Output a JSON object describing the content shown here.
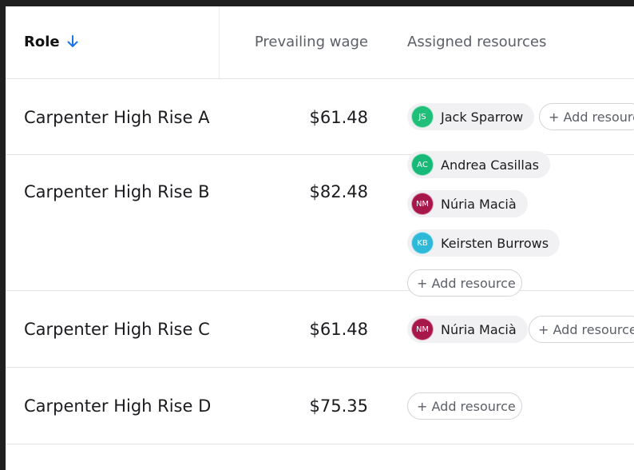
{
  "table": {
    "headers": {
      "role": "Role",
      "wage": "Prevailing wage",
      "resources": "Assigned resources"
    },
    "add_label": "+ Add resource",
    "rows": [
      {
        "role": "Carpenter High Rise A",
        "wage": "$61.48",
        "resources": [
          {
            "initials": "JS",
            "name": "Jack Sparrow",
            "color": "#1fbf7a"
          }
        ]
      },
      {
        "role": "Carpenter High Rise B",
        "wage": "$82.48",
        "resources": [
          {
            "initials": "AC",
            "name": "Andrea Casillas",
            "color": "#17b978"
          },
          {
            "initials": "NM",
            "name": "Núria Macià",
            "color": "#a8174a"
          },
          {
            "initials": "KB",
            "name": "Keirsten Burrows",
            "color": "#2fb9d8"
          }
        ]
      },
      {
        "role": "Carpenter High Rise C",
        "wage": "$61.48",
        "resources": [
          {
            "initials": "NM",
            "name": "Núria Macià",
            "color": "#a8174a"
          }
        ]
      },
      {
        "role": "Carpenter High Rise D",
        "wage": "$75.35",
        "resources": []
      }
    ]
  },
  "colors": {
    "accent": "#1a73e8",
    "border": "#e3e3e6",
    "chip_bg": "#f1f1f3"
  },
  "icons": {
    "sort": "arrow-down-icon"
  }
}
